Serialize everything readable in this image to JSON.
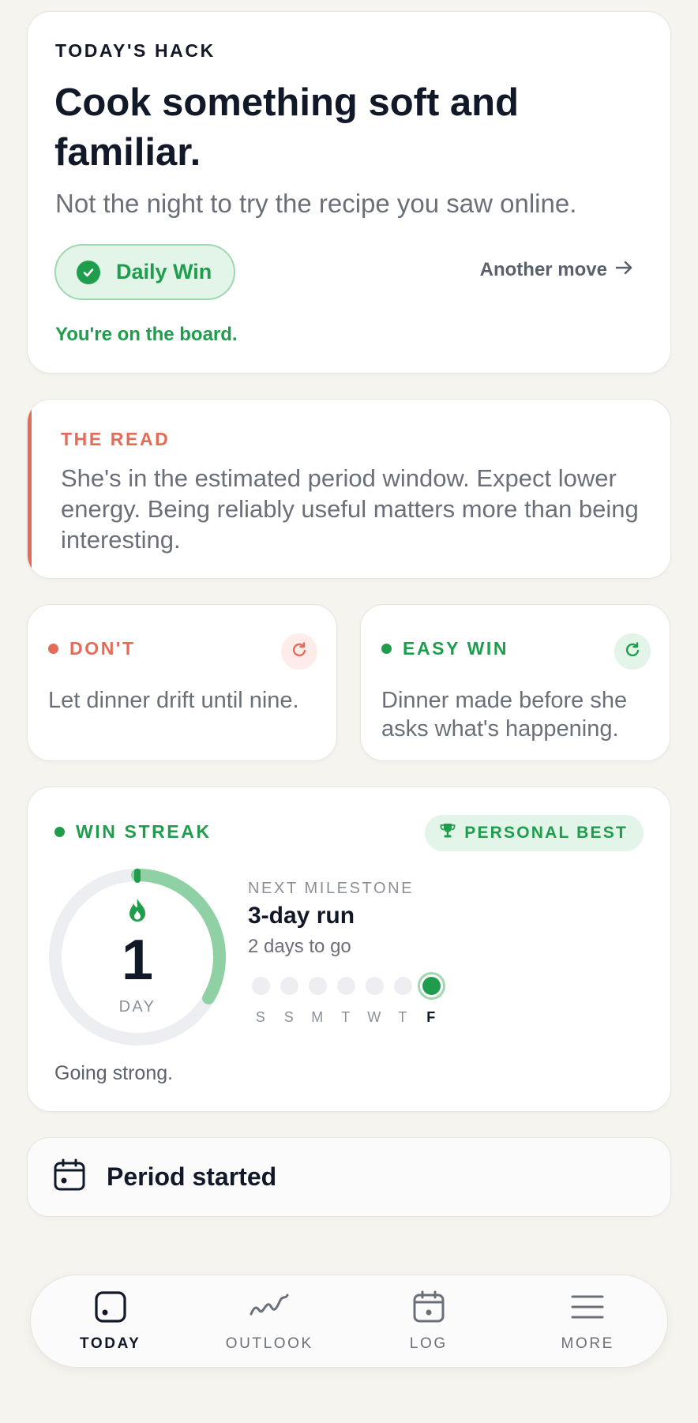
{
  "hack": {
    "eyebrow": "TODAY'S HACK",
    "title": "Cook something soft and familiar.",
    "subtitle": "Not the night to try the recipe you saw online.",
    "win_button": "Daily Win",
    "another_move": "Another move",
    "board_text": "You're on the board."
  },
  "read": {
    "eyebrow": "THE READ",
    "body": "She's in the estimated period window. Expect lower energy. Being reliably useful matters more than being interesting."
  },
  "dont": {
    "label": "DON'T",
    "body": "Let dinner drift until nine."
  },
  "easy_win": {
    "label": "EASY WIN",
    "body": "Dinner made before she asks what's happening."
  },
  "streak": {
    "label": "WIN STREAK",
    "badge": "PERSONAL BEST",
    "count": "1",
    "unit": "DAY",
    "milestone_label": "NEXT MILESTONE",
    "milestone_title": "3-day run",
    "milestone_sub": "2 days to go",
    "progress_fraction": 0.333,
    "week": [
      {
        "label": "S",
        "done": false
      },
      {
        "label": "S",
        "done": false
      },
      {
        "label": "M",
        "done": false
      },
      {
        "label": "T",
        "done": false
      },
      {
        "label": "W",
        "done": false
      },
      {
        "label": "T",
        "done": false
      },
      {
        "label": "F",
        "done": true
      }
    ],
    "footer": "Going strong."
  },
  "period": {
    "label": "Period started"
  },
  "nav": {
    "items": [
      {
        "label": "TODAY",
        "icon": "today-icon",
        "active": true
      },
      {
        "label": "OUTLOOK",
        "icon": "outlook-icon",
        "active": false
      },
      {
        "label": "LOG",
        "icon": "log-icon",
        "active": false
      },
      {
        "label": "MORE",
        "icon": "menu-icon",
        "active": false
      }
    ]
  },
  "colors": {
    "green": "#1f9d4d",
    "red": "#e46b57",
    "background": "#f6f4ef"
  }
}
